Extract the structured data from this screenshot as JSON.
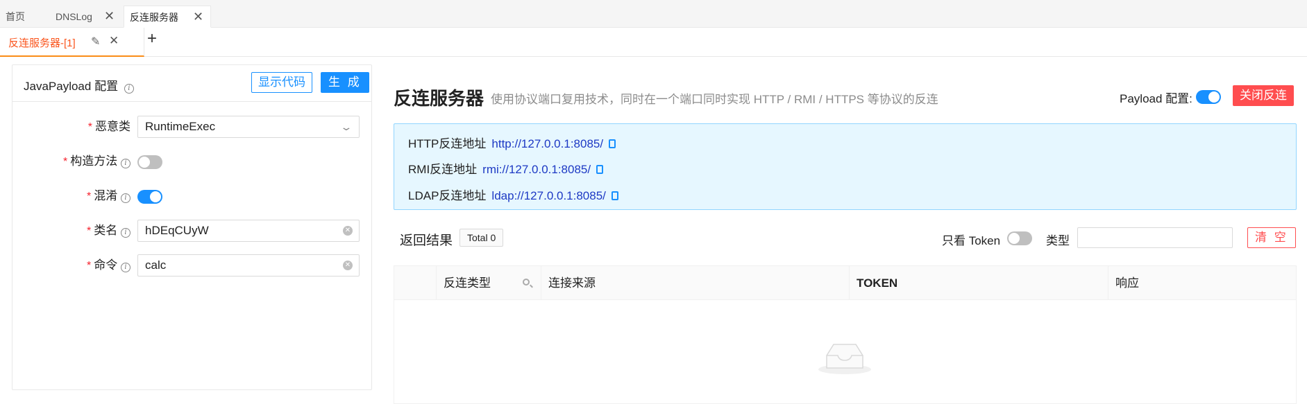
{
  "top_tabs": [
    {
      "label": "首页",
      "closable": false
    },
    {
      "label": "DNSLog",
      "closable": true
    },
    {
      "label": "反连服务器",
      "closable": true,
      "active": true
    }
  ],
  "sub_tab": {
    "label": "反连服务器-[1]",
    "edit_icon": "edit-icon",
    "close_icon": "close-icon",
    "add_icon": "plus-icon"
  },
  "left_panel": {
    "title": "JavaPayload 配置",
    "show_code_label": "显示代码",
    "generate_label": "生 成",
    "fields": {
      "malicious_class": {
        "label": "恶意类",
        "value": "RuntimeExec"
      },
      "constructor": {
        "label": "构造方法",
        "enabled": false
      },
      "obfuscate": {
        "label": "混淆",
        "enabled": true
      },
      "class_name": {
        "label": "类名",
        "value": "hDEqCUyW"
      },
      "command": {
        "label": "命令",
        "value": "calc"
      }
    }
  },
  "right_panel": {
    "title": "反连服务器",
    "description": "使用协议端口复用技术，同时在一个端口同时实现 HTTP / RMI / HTTPS 等协议的反连",
    "payload_config_label": "Payload 配置:",
    "payload_config_enabled": true,
    "close_button": "关闭反连",
    "addresses": [
      {
        "label": "HTTP反连地址",
        "url": "http://127.0.0.1:8085/"
      },
      {
        "label": "RMI反连地址",
        "url": "rmi://127.0.0.1:8085/"
      },
      {
        "label": "LDAP反连地址",
        "url": "ldap://127.0.0.1:8085/"
      }
    ],
    "results_label": "返回结果",
    "total_tag": "Total 0",
    "only_token_label": "只看 Token",
    "only_token_enabled": false,
    "type_label": "类型",
    "type_value": "",
    "clear_button": "清 空",
    "table": {
      "columns": [
        "反连类型",
        "连接来源",
        "TOKEN",
        "响应"
      ],
      "rows": []
    }
  },
  "colors": {
    "primary": "#1890ff",
    "danger": "#ff4d4f",
    "active_tab": "#fa541c",
    "alert_bg": "#e6f7ff"
  }
}
